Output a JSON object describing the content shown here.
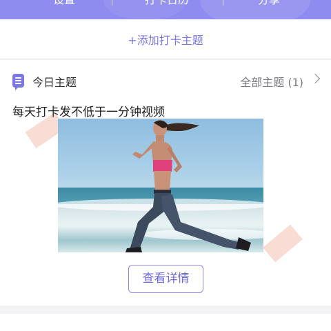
{
  "nav": {
    "items": [
      {
        "label": "设置"
      },
      {
        "label": "打卡日历"
      },
      {
        "label": "分享"
      }
    ]
  },
  "add_topic": {
    "label": "+添加打卡主题"
  },
  "topic_card": {
    "title": "今日主题",
    "all_topics": "全部主题 (1)",
    "topic_text": "每天打卡发不低于一分钟视频",
    "detail_button": "查看详情"
  },
  "colors": {
    "accent": "#7b78e6",
    "nav_bg": "#8f8cf0",
    "deco": "#f8d8cf"
  },
  "icons": [
    "topic-list-icon",
    "chevron-right-icon"
  ]
}
